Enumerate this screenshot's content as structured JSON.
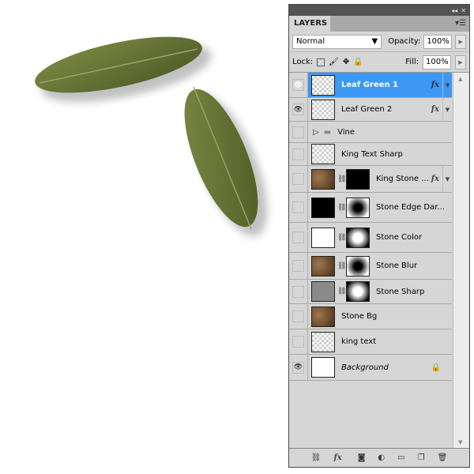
{
  "panel": {
    "tab": "LAYERS",
    "blend_mode": "Normal",
    "opacity_label": "Opacity:",
    "opacity": "100%",
    "lock_label": "Lock:",
    "fill_label": "Fill:",
    "fill": "100%",
    "fx_label": "fx"
  },
  "layers": [
    {
      "name": "Leaf Green 1",
      "visible": true,
      "active": true,
      "fx": true,
      "thumb": "checker"
    },
    {
      "name": "Leaf Green 2",
      "visible": true,
      "fx": true,
      "thumb": "checker"
    },
    {
      "name": "Vine",
      "group": true
    },
    {
      "name": "King Text Sharp",
      "thumb": "checker"
    },
    {
      "name": "King Stone ...",
      "fx": true,
      "thumb": "stone",
      "mask": "black"
    },
    {
      "name": "Stone Edge Dar...",
      "thumb": "black",
      "mask": "mask-dark"
    },
    {
      "name": "Stone Color",
      "thumb": "white",
      "mask": "mask-light"
    },
    {
      "name": "Stone Blur",
      "thumb": "stone",
      "mask": "mask-dark"
    },
    {
      "name": "Stone Sharp",
      "thumb": "stonegray",
      "mask": "mask-light"
    },
    {
      "name": "Stone Bg",
      "thumb": "stone"
    },
    {
      "name": "king text",
      "thumb": "checker"
    },
    {
      "name": "Background",
      "visible": true,
      "locked": true,
      "italic": true,
      "thumb": "white"
    }
  ]
}
